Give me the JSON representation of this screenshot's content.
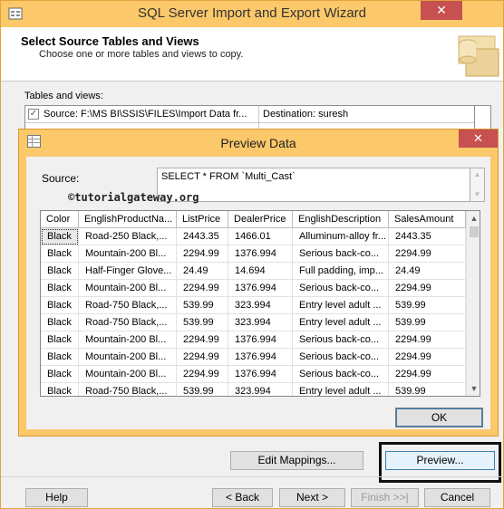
{
  "wizard": {
    "title": "SQL Server Import and Export Wizard",
    "close_glyph": "✕",
    "header_title": "Select Source Tables and Views",
    "header_subtitle": "Choose one or more tables and views to copy.",
    "tables_label": "Tables and views:",
    "tables_header": {
      "checked": "✓",
      "source": "Source: F:\\MS BI\\SSIS\\FILES\\Import Data fr...",
      "destination": "Destination: suresh"
    },
    "buttons": {
      "edit_mappings": "Edit Mappings...",
      "preview": "Preview...",
      "help": "Help",
      "back": "< Back",
      "next": "Next >",
      "finish": "Finish >>|",
      "cancel": "Cancel"
    }
  },
  "dialog": {
    "title": "Preview Data",
    "close_glyph": "✕",
    "source_label": "Source:",
    "source_query": "SELECT * FROM `Multi_Cast`",
    "watermark": "©tutorialgateway.org",
    "ok_label": "OK",
    "columns": [
      "Color",
      "EnglishProductNa...",
      "ListPrice",
      "DealerPrice",
      "EnglishDescription",
      "SalesAmount"
    ],
    "rows": [
      [
        "Black",
        "Road-250 Black,...",
        "2443.35",
        "1466.01",
        "Alluminum-alloy fr...",
        "2443.35"
      ],
      [
        "Black",
        "Mountain-200 Bl...",
        "2294.99",
        "1376.994",
        "Serious back-co...",
        "2294.99"
      ],
      [
        "Black",
        "Half-Finger Glove...",
        "24.49",
        "14.694",
        "Full padding, imp...",
        "24.49"
      ],
      [
        "Black",
        "Mountain-200 Bl...",
        "2294.99",
        "1376.994",
        "Serious back-co...",
        "2294.99"
      ],
      [
        "Black",
        "Road-750 Black,...",
        "539.99",
        "323.994",
        "Entry level adult ...",
        "539.99"
      ],
      [
        "Black",
        "Road-750 Black,...",
        "539.99",
        "323.994",
        "Entry level adult ...",
        "539.99"
      ],
      [
        "Black",
        "Mountain-200 Bl...",
        "2294.99",
        "1376.994",
        "Serious back-co...",
        "2294.99"
      ],
      [
        "Black",
        "Mountain-200 Bl...",
        "2294.99",
        "1376.994",
        "Serious back-co...",
        "2294.99"
      ],
      [
        "Black",
        "Mountain-200 Bl...",
        "2294.99",
        "1376.994",
        "Serious back-co...",
        "2294.99"
      ],
      [
        "Black",
        "Road-750 Black,...",
        "539.99",
        "323.994",
        "Entry level adult ...",
        "539.99"
      ]
    ]
  },
  "icons": {
    "app": "wizard-app-icon",
    "dialog": "preview-grid-icon",
    "header_art": "database-import-art",
    "scroll_up": "▲",
    "scroll_down": "▼"
  },
  "colors": {
    "titlebar": "#fbc86a",
    "close": "#c75050",
    "highlight_box": "#111111"
  }
}
